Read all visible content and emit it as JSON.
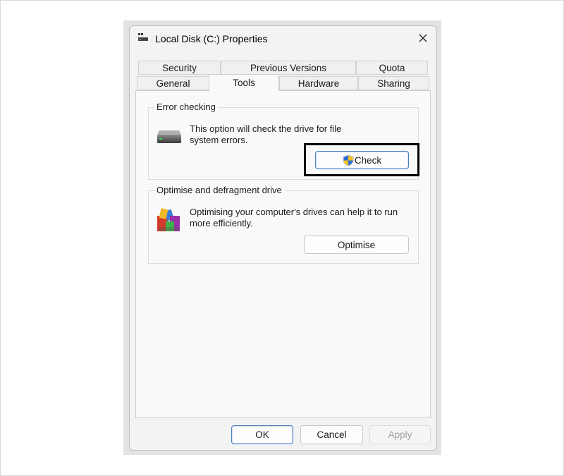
{
  "window": {
    "title": "Local Disk (C:) Properties"
  },
  "tabs": {
    "row1": [
      "Security",
      "Previous Versions",
      "Quota"
    ],
    "row2": [
      "General",
      "Tools",
      "Hardware",
      "Sharing"
    ],
    "active": "Tools"
  },
  "error_checking": {
    "title": "Error checking",
    "description_line1": "This option will check the drive for file",
    "description_line2": "system errors.",
    "button_label": "Check"
  },
  "optimise": {
    "title": "Optimise and defragment drive",
    "description_line1": "Optimising your computer's drives can help it to run",
    "description_line2": "more efficiently.",
    "button_label": "Optimise"
  },
  "footer": {
    "ok": "OK",
    "cancel": "Cancel",
    "apply": "Apply"
  },
  "colors": {
    "accent": "#4a7fc0",
    "highlight": "#000000",
    "window_bg": "#f3f3f3"
  }
}
